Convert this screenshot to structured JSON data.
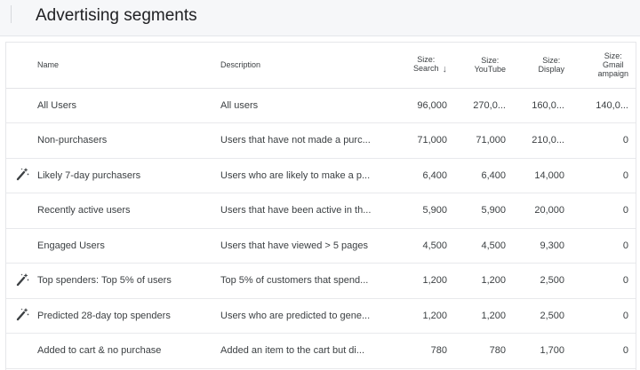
{
  "header": {
    "title": "Advertising segments"
  },
  "table": {
    "columns": {
      "name": "Name",
      "description": "Description",
      "search": [
        "Size:",
        "Search"
      ],
      "youtube": [
        "Size:",
        "YouTube"
      ],
      "display": [
        "Size:",
        "Display"
      ],
      "gmail": [
        "Size:",
        "Gmail",
        "ampaign"
      ]
    },
    "sort_icon": "arrow-down-icon",
    "rows": [
      {
        "predicted": false,
        "name": "All Users",
        "description": "All users",
        "search": "96,000",
        "youtube": "270,0...",
        "display": "160,0...",
        "gmail": "140,0..."
      },
      {
        "predicted": false,
        "name": "Non-purchasers",
        "description": "Users that have not made a purc...",
        "search": "71,000",
        "youtube": "71,000",
        "display": "210,0...",
        "gmail": "0"
      },
      {
        "predicted": true,
        "name": "Likely 7-day purchasers",
        "description": "Users who are likely to make a p...",
        "search": "6,400",
        "youtube": "6,400",
        "display": "14,000",
        "gmail": "0"
      },
      {
        "predicted": false,
        "name": "Recently active users",
        "description": "Users that have been active in th...",
        "search": "5,900",
        "youtube": "5,900",
        "display": "20,000",
        "gmail": "0"
      },
      {
        "predicted": false,
        "name": "Engaged Users",
        "description": "Users that have viewed > 5 pages",
        "search": "4,500",
        "youtube": "4,500",
        "display": "9,300",
        "gmail": "0"
      },
      {
        "predicted": true,
        "name": "Top spenders: Top 5% of users",
        "description": "Top 5% of customers that spend...",
        "search": "1,200",
        "youtube": "1,200",
        "display": "2,500",
        "gmail": "0"
      },
      {
        "predicted": true,
        "name": "Predicted 28-day top spenders",
        "description": "Users who are predicted to gene...",
        "search": "1,200",
        "youtube": "1,200",
        "display": "2,500",
        "gmail": "0"
      },
      {
        "predicted": false,
        "name": "Added to cart & no purchase",
        "description": "Added an item to the cart but di...",
        "search": "780",
        "youtube": "780",
        "display": "1,700",
        "gmail": "0"
      }
    ]
  }
}
